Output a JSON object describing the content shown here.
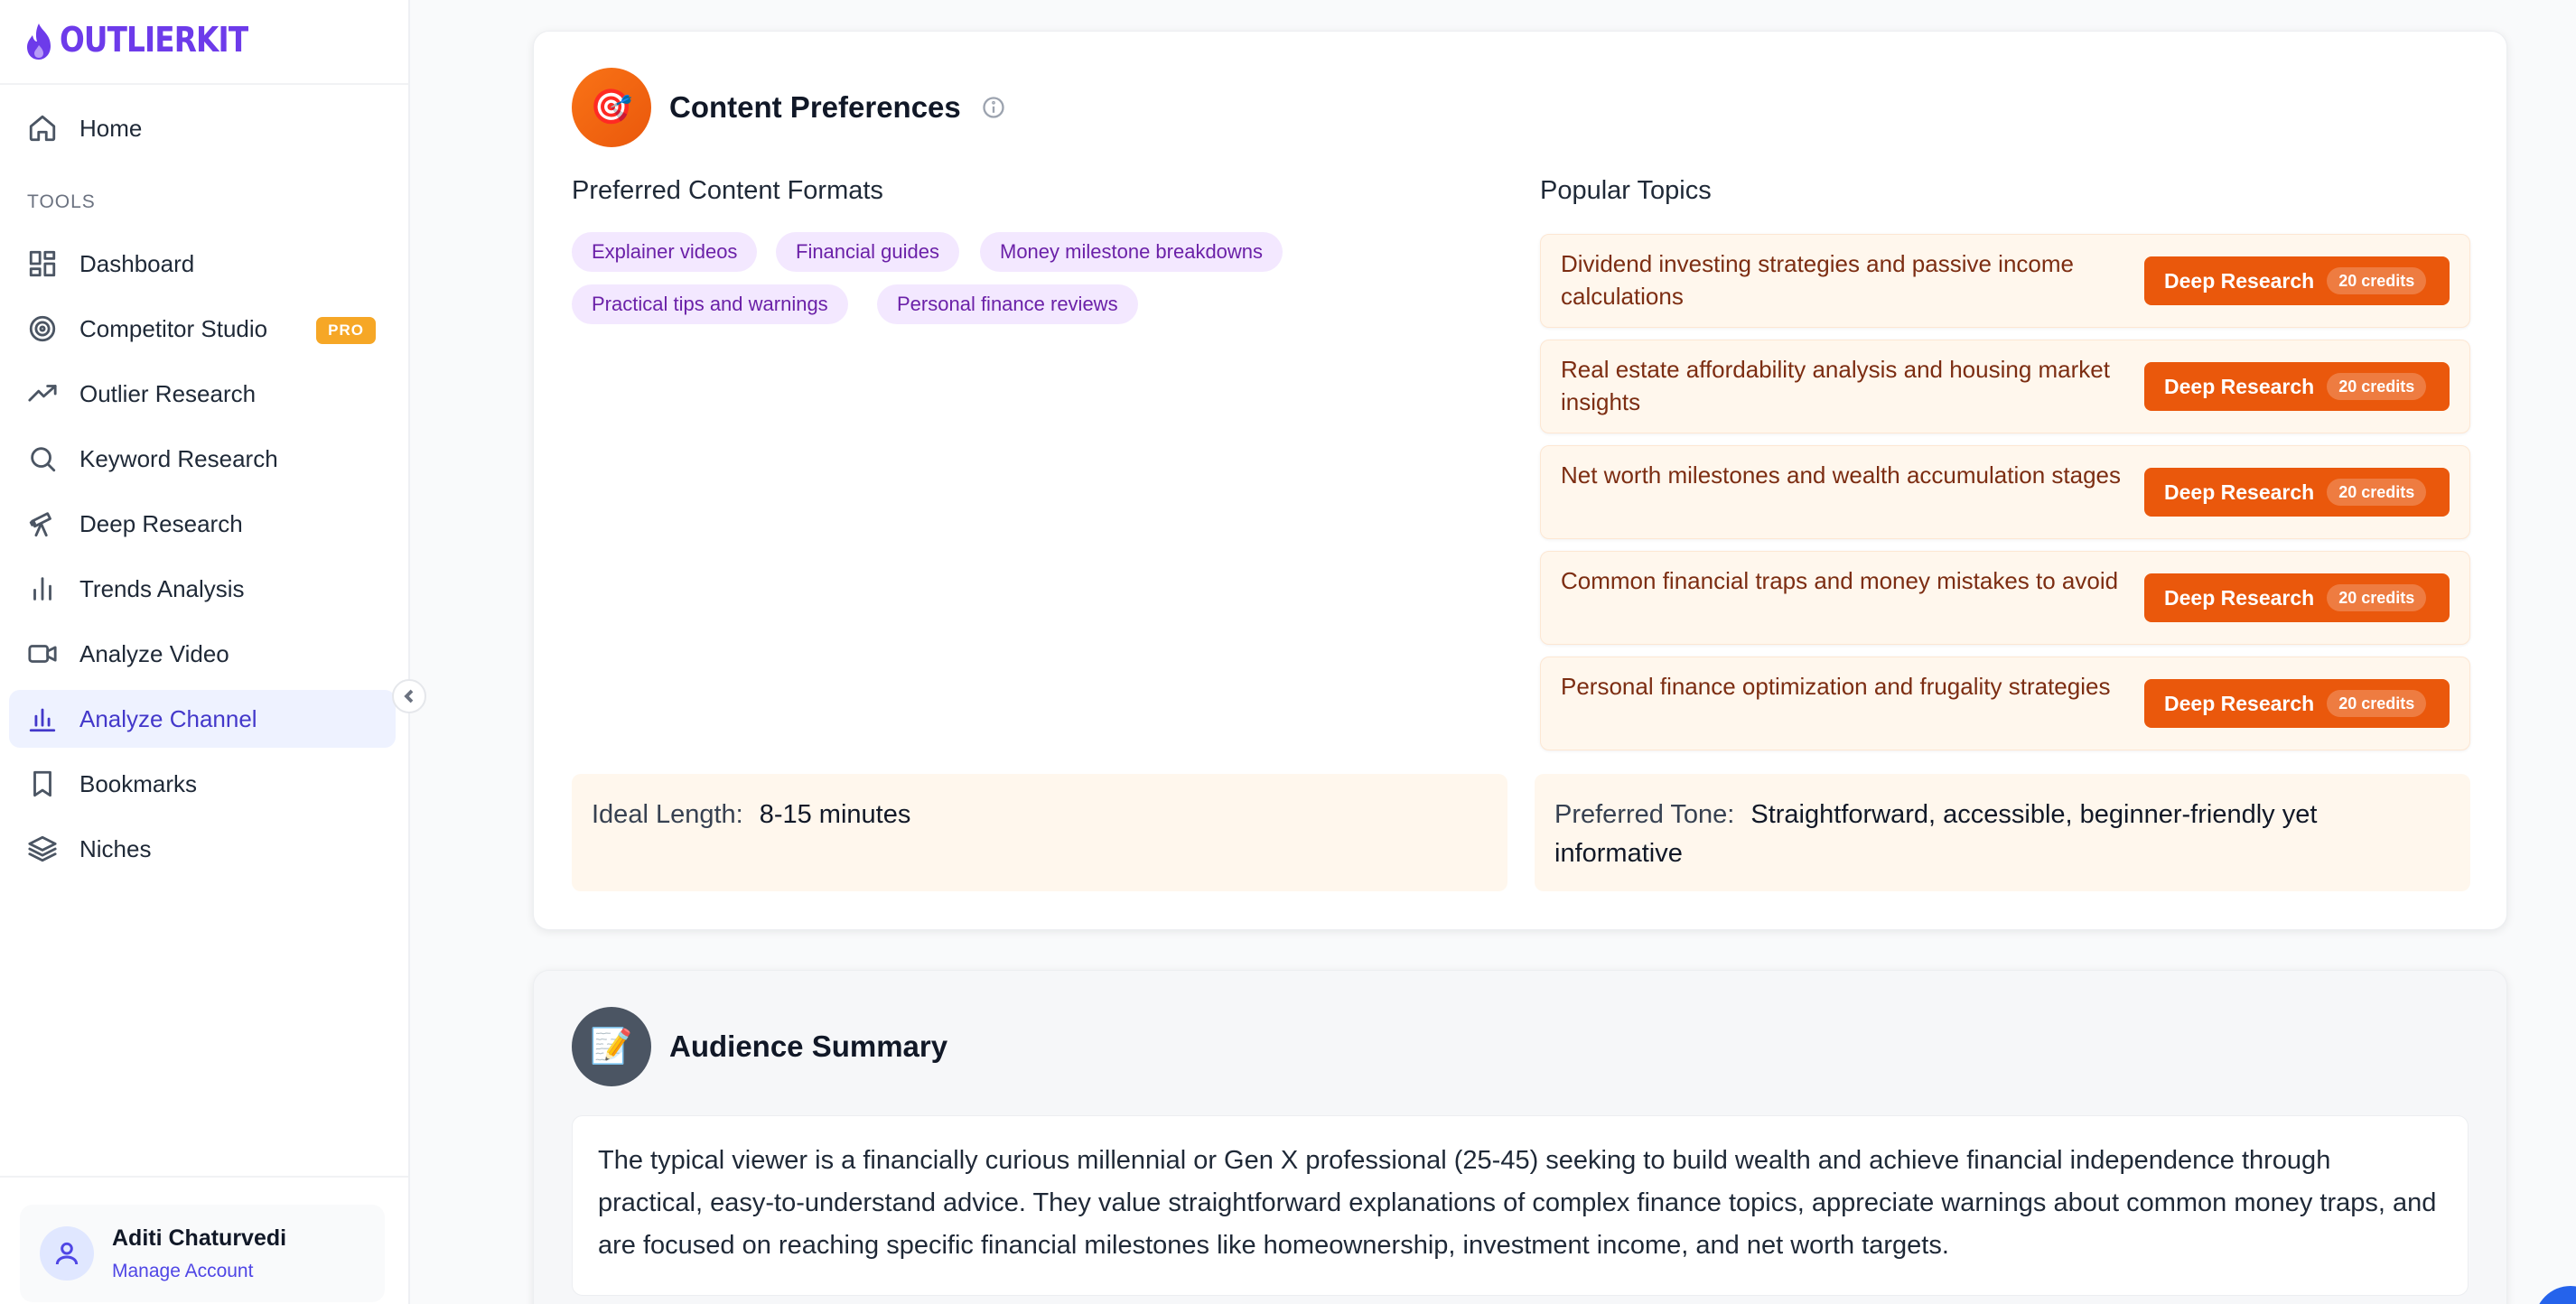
{
  "brand": {
    "name": "OUTLIERKIT",
    "color": "#6d3bea"
  },
  "sidebar": {
    "home_label": "Home",
    "section_label": "TOOLS",
    "items": [
      {
        "label": "Dashboard",
        "icon": "dashboard-icon"
      },
      {
        "label": "Competitor Studio",
        "icon": "target-icon",
        "badge": "PRO"
      },
      {
        "label": "Outlier Research",
        "icon": "trending-up-icon"
      },
      {
        "label": "Keyword Research",
        "icon": "search-icon"
      },
      {
        "label": "Deep Research",
        "icon": "telescope-icon"
      },
      {
        "label": "Trends Analysis",
        "icon": "bar-chart-icon"
      },
      {
        "label": "Analyze Video",
        "icon": "video-icon"
      },
      {
        "label": "Analyze Channel",
        "icon": "channel-chart-icon",
        "active": true
      },
      {
        "label": "Bookmarks",
        "icon": "bookmark-icon"
      },
      {
        "label": "Niches",
        "icon": "layers-icon"
      }
    ],
    "account": {
      "name": "Aditi Chaturvedi",
      "link": "Manage Account"
    }
  },
  "content_prefs": {
    "icon": "🎯",
    "title": "Content Preferences",
    "formats_title": "Preferred Content Formats",
    "formats": [
      "Explainer videos",
      "Financial guides",
      "Money milestone breakdowns",
      "Practical tips and warnings",
      "Personal finance reviews"
    ],
    "topics_title": "Popular Topics",
    "topics": [
      {
        "text": "Dividend investing strategies and passive income calculations",
        "button": "Deep Research",
        "credits": "20 credits"
      },
      {
        "text": "Real estate affordability analysis and housing market insights",
        "button": "Deep Research",
        "credits": "20 credits"
      },
      {
        "text": "Net worth milestones and wealth accumulation stages",
        "button": "Deep Research",
        "credits": "20 credits"
      },
      {
        "text": "Common financial traps and money mistakes to avoid",
        "button": "Deep Research",
        "credits": "20 credits"
      },
      {
        "text": "Personal finance optimization and frugality strategies",
        "button": "Deep Research",
        "credits": "20 credits"
      }
    ],
    "ideal_length_label": "Ideal Length:",
    "ideal_length_value": "8-15 minutes",
    "tone_label": "Preferred Tone:",
    "tone_value": "Straightforward, accessible, beginner-friendly yet informative"
  },
  "audience": {
    "icon": "📝",
    "title": "Audience Summary",
    "text": "The typical viewer is a financially curious millennial or Gen X professional (25-45) seeking to build wealth and achieve financial independence through practical, easy-to-understand advice. They value straightforward explanations of complex finance topics, appreciate warnings about common money traps, and are focused on reaching specific financial milestones like homeownership, investment income, and net worth targets."
  },
  "colors": {
    "accent_orange": "#ea580c",
    "tag_purple": "#f3e8ff",
    "active_nav": "#4338ca"
  }
}
